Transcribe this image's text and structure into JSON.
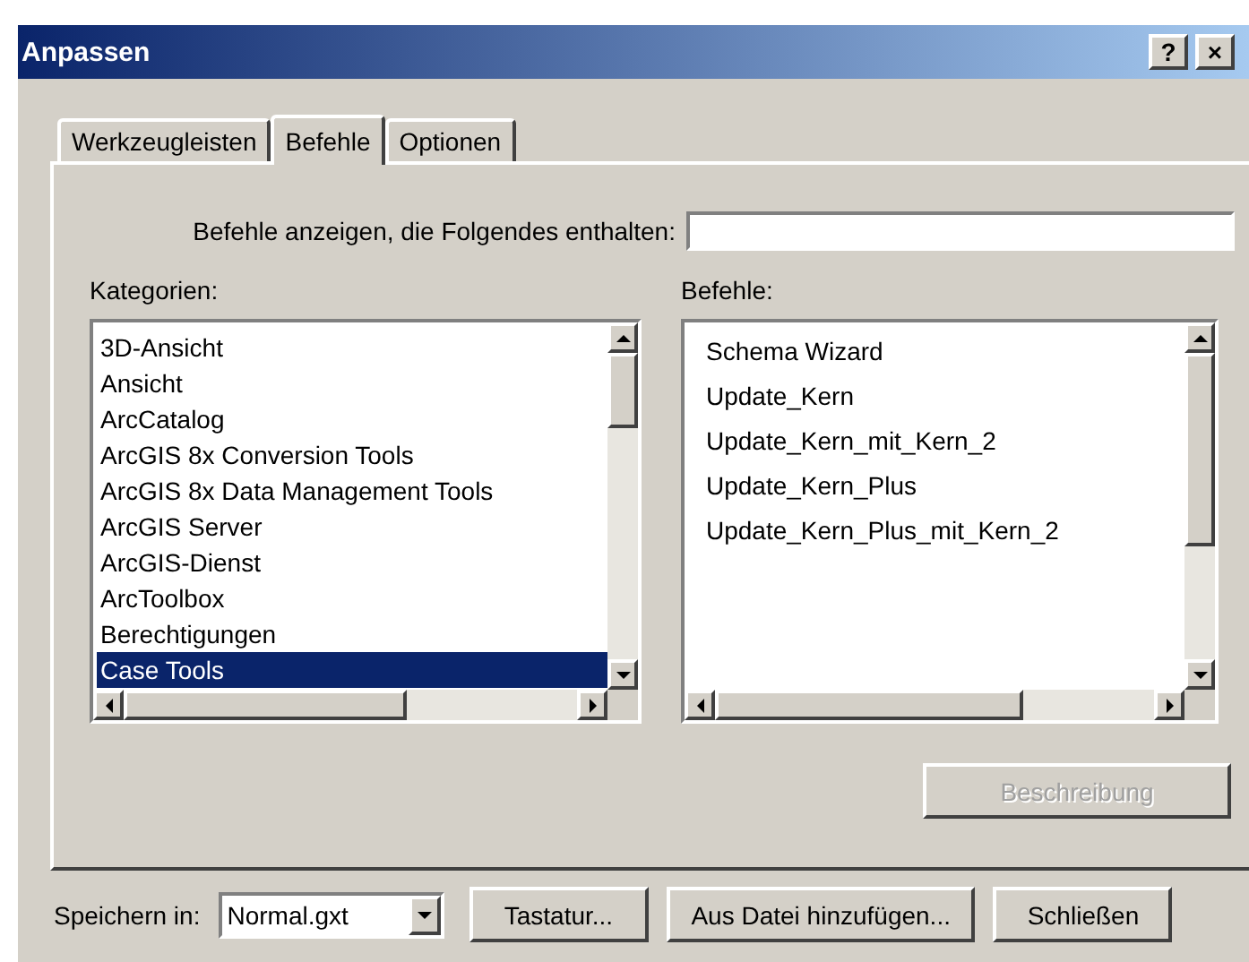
{
  "window": {
    "title": "Anpassen",
    "help_button": "?",
    "close_button": "×"
  },
  "tabs": [
    {
      "label": "Werkzeugleisten",
      "selected": false
    },
    {
      "label": "Befehle",
      "selected": true
    },
    {
      "label": "Optionen",
      "selected": false
    }
  ],
  "search": {
    "label": "Befehle anzeigen, die Folgendes enthalten:"
  },
  "categories": {
    "label": "Kategorien:",
    "items": [
      {
        "label": "3D-Ansicht",
        "selected": false
      },
      {
        "label": "Ansicht",
        "selected": false
      },
      {
        "label": "ArcCatalog",
        "selected": false
      },
      {
        "label": "ArcGIS 8x Conversion Tools",
        "selected": false
      },
      {
        "label": "ArcGIS 8x Data Management Tools",
        "selected": false
      },
      {
        "label": "ArcGIS Server",
        "selected": false
      },
      {
        "label": "ArcGIS-Dienst",
        "selected": false
      },
      {
        "label": "ArcToolbox",
        "selected": false
      },
      {
        "label": "Berechtigungen",
        "selected": false
      },
      {
        "label": "Case Tools",
        "selected": true
      }
    ]
  },
  "commands": {
    "label": "Befehle:",
    "items": [
      {
        "label": "Schema Wizard",
        "selected": false
      },
      {
        "label": "Update_Kern",
        "selected": false
      },
      {
        "label": "Update_Kern_mit_Kern_2",
        "selected": false
      },
      {
        "label": "Update_Kern_Plus",
        "selected": false
      },
      {
        "label": "Update_Kern_Plus_mit_Kern_2",
        "selected": false
      }
    ]
  },
  "description_button": {
    "label": "Beschreibung",
    "disabled": true
  },
  "save_in": {
    "label": "Speichern in:",
    "value": "Normal.gxt"
  },
  "buttons": [
    "Tastatur...",
    "Aus Datei hinzufügen...",
    "Schließen"
  ]
}
